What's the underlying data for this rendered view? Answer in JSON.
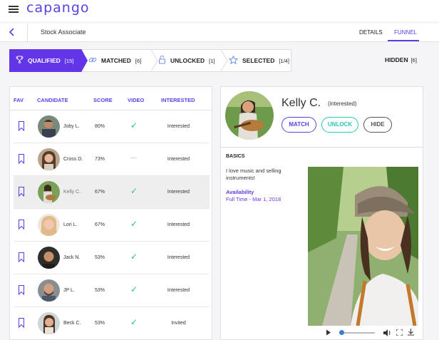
{
  "app": {
    "logo_text": "capango",
    "brand_color": "#5a3ee6",
    "accent_color": "#26c6b8"
  },
  "header": {
    "job_title": "Stock Associate",
    "tabs": [
      {
        "label": "DETAILS"
      },
      {
        "label": "FUNNEL",
        "active": true
      }
    ]
  },
  "funnel": {
    "stages": [
      {
        "label": "QUALIFIED",
        "count": "[15]",
        "icon": "trophy-icon",
        "active": true
      },
      {
        "label": "MATCHED",
        "count": "[6]",
        "icon": "link-icon"
      },
      {
        "label": "UNLOCKED",
        "count": "[1]",
        "icon": "unlock-icon"
      },
      {
        "label": "SELECTED",
        "count": "[1/4]",
        "icon": "star-icon"
      }
    ],
    "hidden": {
      "label": "HIDDEN",
      "count": "[6]"
    }
  },
  "list": {
    "columns": [
      "FAV",
      "CANDIDATE",
      "SCORE",
      "VIDEO",
      "INTERESTED"
    ],
    "rows": [
      {
        "name": "Joby L.",
        "score": "80%",
        "video": "✓",
        "interested": "Interested"
      },
      {
        "name": "Cross D.",
        "score": "73%",
        "video": "—",
        "interested": "Interested"
      },
      {
        "name": "Kelly C.",
        "score": "67%",
        "video": "✓",
        "interested": "Interested",
        "selected": true
      },
      {
        "name": "Lori L.",
        "score": "67%",
        "video": "✓",
        "interested": "Interested"
      },
      {
        "name": "Jack N.",
        "score": "53%",
        "video": "✓",
        "interested": "Interested"
      },
      {
        "name": "JP L.",
        "score": "53%",
        "video": "✓",
        "interested": "Interested"
      },
      {
        "name": "Beck C.",
        "score": "53%",
        "video": "✓",
        "interested": "Invited"
      }
    ]
  },
  "detail": {
    "name": "Kelly C.",
    "status": "(interested)",
    "buttons": {
      "match": "MATCH",
      "unlock": "UNLOCK",
      "hide": "HIDE"
    },
    "section": "BASICS",
    "bio": "I love music and selling instruments!",
    "availability_label": "Availability",
    "availability_value": "Full Time - Mar 1, 2018",
    "video_controls": {
      "playing": false
    }
  }
}
